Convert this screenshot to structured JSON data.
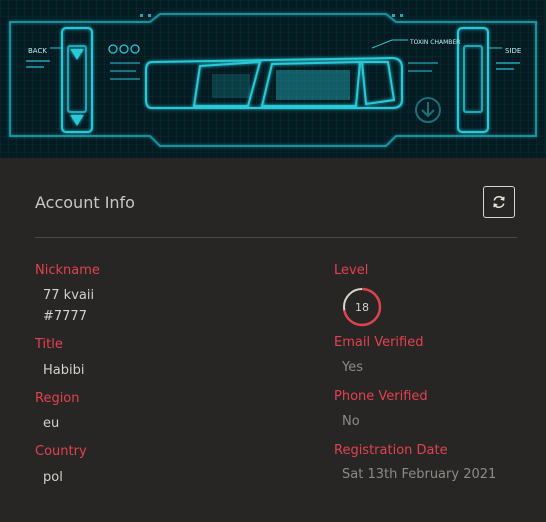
{
  "banner": {
    "label_back": "BACK",
    "label_side": "SIDE",
    "label_chamber": "TOXIN\nCHAMBER"
  },
  "account": {
    "title": "Account Info",
    "refresh_icon": "refresh-icon",
    "nickname_label": "Nickname",
    "nickname_name": "77 kvaii",
    "nickname_tag": "#7777",
    "title_label": "Title",
    "title_value": "Habibi",
    "region_label": "Region",
    "region_value": "eu",
    "country_label": "Country",
    "country_value": "pol",
    "level_label": "Level",
    "level_value": "18",
    "level_progress": 0.72,
    "email_label": "Email Verified",
    "email_value": "Yes",
    "phone_label": "Phone Verified",
    "phone_value": "No",
    "registration_label": "Registration Date",
    "registration_value": "Sat 13th February 2021"
  },
  "colors": {
    "accent": "#e0424f",
    "banner_glow": "#2fd6e6"
  }
}
